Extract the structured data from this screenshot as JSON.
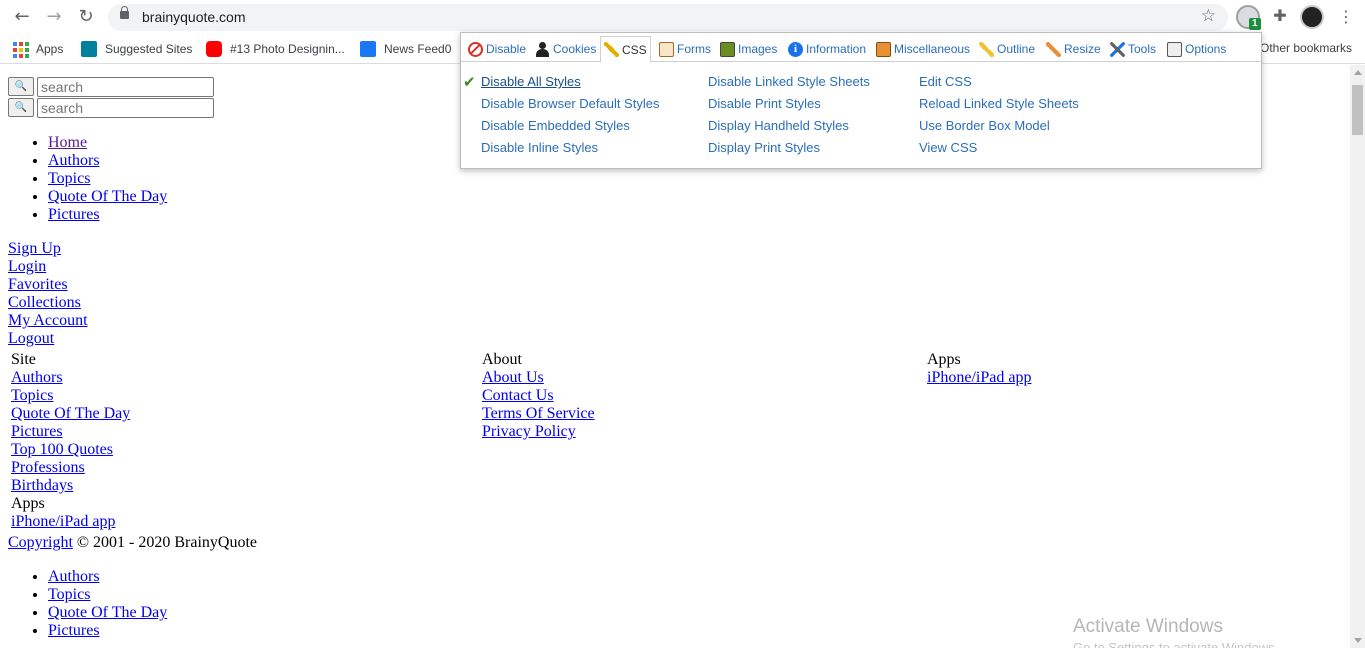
{
  "browser": {
    "url": "brainyquote.com",
    "nav": {
      "back": "←",
      "forward": "→",
      "reload": "↻"
    },
    "star": "☆",
    "ext_badge": "1",
    "ext_menu": "⋮",
    "ext_puzzle": "✚"
  },
  "bookmarks": {
    "items": [
      {
        "label": "Apps",
        "icon": "apps-grid-icon"
      },
      {
        "label": "Suggested Sites",
        "icon": "bing-icon",
        "color": "#00809d"
      },
      {
        "label": "#13 Photo Designin...",
        "icon": "youtube-icon",
        "color": "#ff0000"
      },
      {
        "label": "News Feed0",
        "icon": "facebook-icon",
        "color": "#1877f2"
      }
    ],
    "other": "Other bookmarks"
  },
  "webdev": {
    "tabs": [
      {
        "label": "Disable",
        "icon": "disable-icon"
      },
      {
        "label": "Cookies",
        "icon": "cookies-icon"
      },
      {
        "label": "CSS",
        "icon": "css-icon",
        "active": true
      },
      {
        "label": "Forms",
        "icon": "forms-icon"
      },
      {
        "label": "Images",
        "icon": "images-icon"
      },
      {
        "label": "Information",
        "icon": "information-icon"
      },
      {
        "label": "Miscellaneous",
        "icon": "miscellaneous-icon"
      },
      {
        "label": "Outline",
        "icon": "outline-icon"
      },
      {
        "label": "Resize",
        "icon": "resize-icon"
      },
      {
        "label": "Tools",
        "icon": "tools-icon"
      },
      {
        "label": "Options",
        "icon": "options-icon"
      }
    ],
    "col1": [
      "Disable All Styles",
      "Disable Browser Default Styles",
      "Disable Embedded Styles",
      "Disable Inline Styles"
    ],
    "col2": [
      "Disable Linked Style Sheets",
      "Disable Print Styles",
      "Display Handheld Styles",
      "Display Print Styles"
    ],
    "col3": [
      "Edit CSS",
      "Reload Linked Style Sheets",
      "Use Border Box Model",
      "View CSS"
    ],
    "checkmark": "✔"
  },
  "page": {
    "search_button": "🔍",
    "search_placeholder": "search",
    "nav": [
      "Home",
      "Authors",
      "Topics",
      "Quote Of The Day",
      "Pictures"
    ],
    "account": [
      "Sign Up",
      "Login",
      "Favorites",
      "Collections",
      "My Account",
      "Logout"
    ],
    "footer": {
      "site": {
        "heading": "Site",
        "links": [
          "Authors",
          "Topics",
          "Quote Of The Day",
          "Pictures",
          "Top 100 Quotes",
          "Professions",
          "Birthdays"
        ]
      },
      "apps_inline": {
        "heading": "Apps",
        "links": [
          "iPhone/iPad app"
        ]
      },
      "about": {
        "heading": "About",
        "links": [
          "About Us",
          "Contact Us",
          "Terms Of Service",
          "Privacy Policy"
        ]
      },
      "apps": {
        "heading": "Apps",
        "links": [
          "iPhone/iPad app"
        ]
      }
    },
    "copyright_link": "Copyright",
    "copyright_text": " © 2001 - 2020 BrainyQuote",
    "bottom_nav": [
      "Authors",
      "Topics",
      "Quote Of The Day",
      "Pictures"
    ]
  },
  "watermark": {
    "title": "Activate Windows",
    "subtitle": "Go to Settings to activate Windows."
  }
}
